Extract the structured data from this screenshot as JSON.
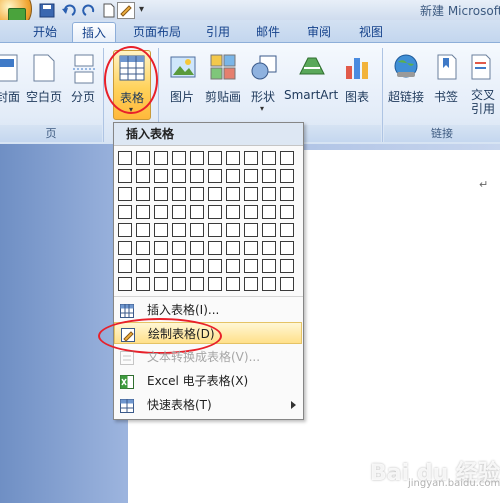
{
  "window": {
    "title": "新建 Microsoft"
  },
  "tabs": [
    {
      "label": "开始"
    },
    {
      "label": "插入"
    },
    {
      "label": "页面布局"
    },
    {
      "label": "引用"
    },
    {
      "label": "邮件"
    },
    {
      "label": "审阅"
    },
    {
      "label": "视图"
    }
  ],
  "ribbon": {
    "pages_group": {
      "label": "页",
      "buttons": [
        {
          "label": "封面"
        },
        {
          "label": "空白页"
        },
        {
          "label": "分页"
        }
      ]
    },
    "table_button": {
      "label": "表格"
    },
    "illustrations": [
      {
        "label": "图片"
      },
      {
        "label": "剪贴画"
      },
      {
        "label": "形状"
      },
      {
        "label": "SmartArt"
      },
      {
        "label": "图表"
      }
    ],
    "links_group": {
      "label": "链接",
      "buttons": [
        {
          "label": "超链接"
        },
        {
          "label": "书签"
        },
        {
          "label": "交叉引用"
        }
      ]
    }
  },
  "dropdown": {
    "header": "插入表格",
    "grid": {
      "columns": 10,
      "rows": 8
    },
    "items": [
      {
        "label": "插入表格(I)...",
        "enabled": true
      },
      {
        "label": "绘制表格(D)",
        "enabled": true,
        "highlighted": true
      },
      {
        "label": "文本转换成表格(V)...",
        "enabled": false
      },
      {
        "label": "Excel 电子表格(X)",
        "enabled": true
      },
      {
        "label": "快速表格(T)",
        "enabled": true,
        "submenu": true
      }
    ]
  },
  "document": {
    "paragraph_mark": "↵"
  },
  "watermark": {
    "text": "Bai du 经验",
    "sub": "jingyan.baidu.com"
  },
  "colors": {
    "accent": "#15428b",
    "highlight": "#ffd25b",
    "annotation": "#e8202a"
  }
}
